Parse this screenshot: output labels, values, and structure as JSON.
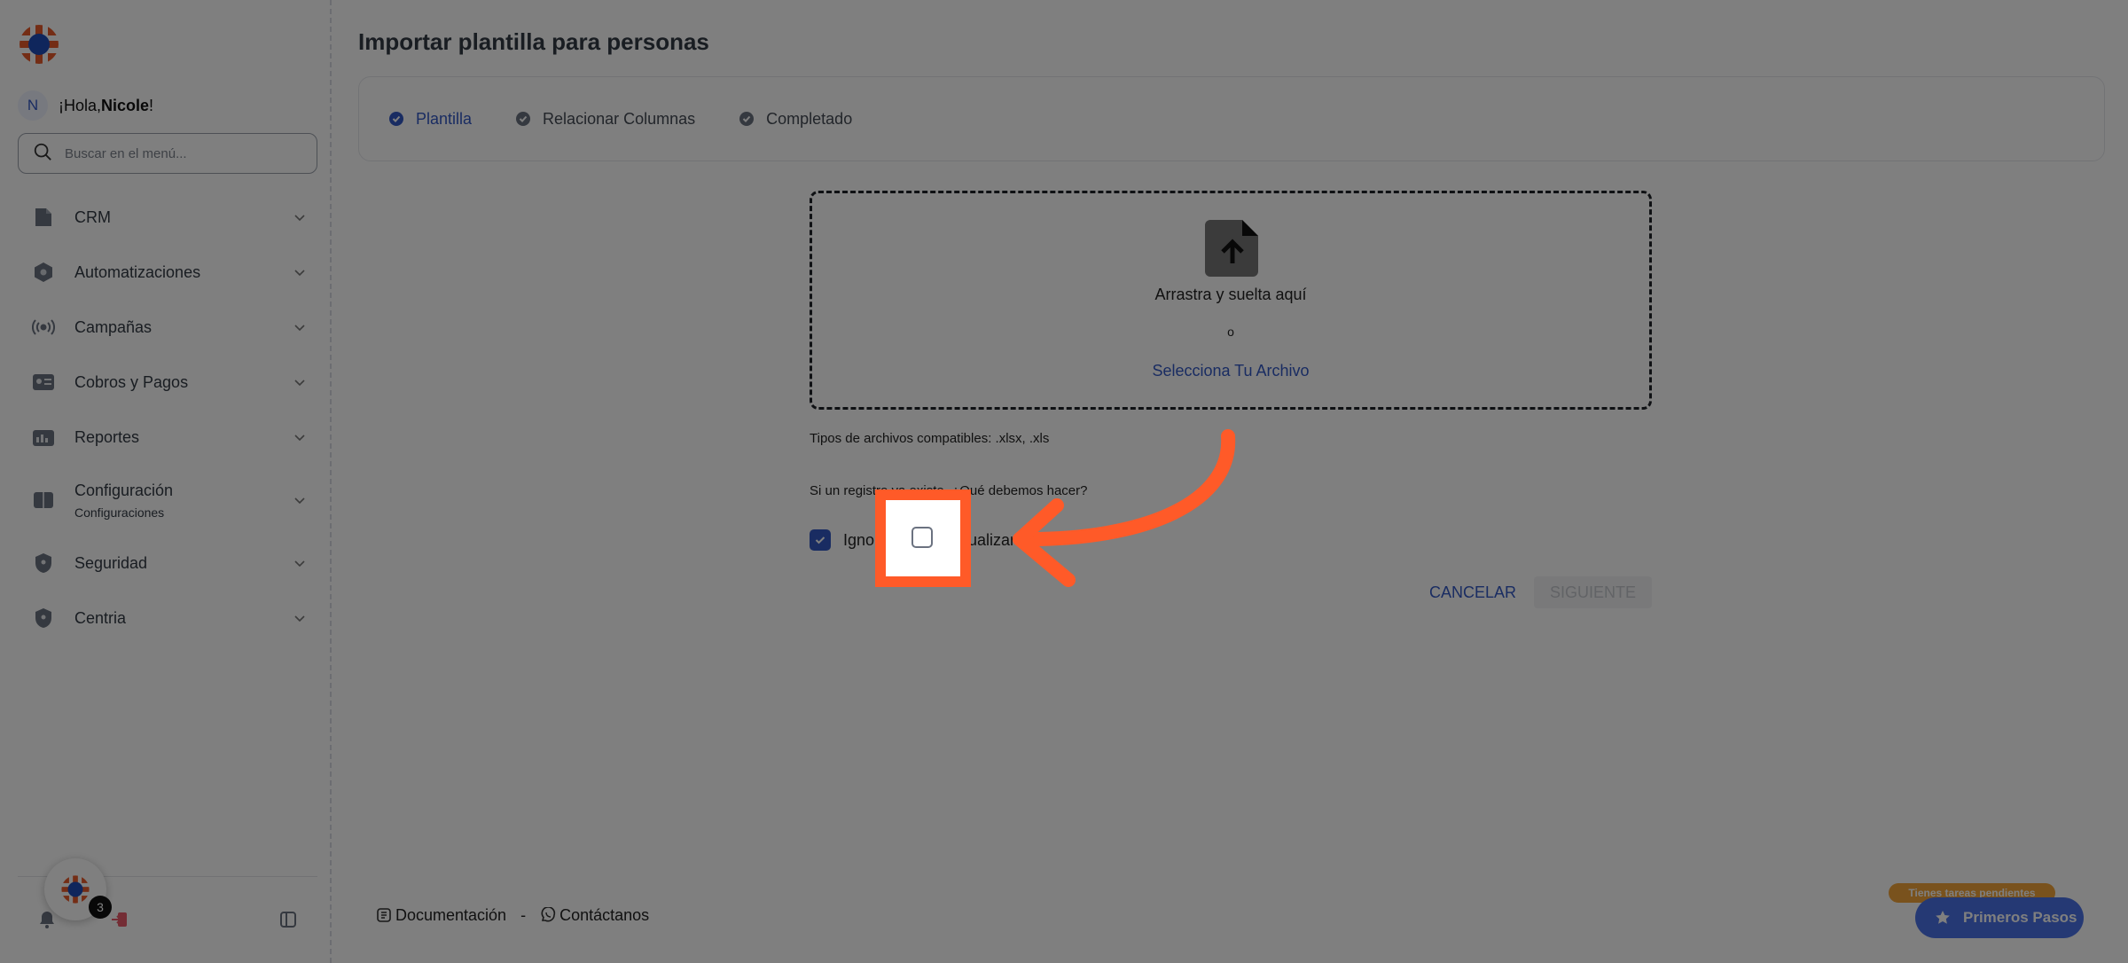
{
  "sidebar": {
    "avatar_initial": "N",
    "greeting_prefix": "¡Hola, ",
    "user_name": "Nicole",
    "greeting_suffix": "!",
    "search_placeholder": "Buscar en el menú...",
    "items": [
      {
        "label": "CRM",
        "icon": "file-icon"
      },
      {
        "label": "Automatizaciones",
        "icon": "hexagon-icon"
      },
      {
        "label": "Campañas",
        "icon": "broadcast-icon"
      },
      {
        "label": "Cobros y Pagos",
        "icon": "id-card-icon"
      },
      {
        "label": "Reportes",
        "icon": "chart-card-icon"
      },
      {
        "label": "Configuración",
        "sublabel": "Configuraciones",
        "icon": "book-icon"
      },
      {
        "label": "Seguridad",
        "icon": "shield-icon"
      },
      {
        "label": "Centria",
        "icon": "shield-icon"
      }
    ],
    "notification_count": "3"
  },
  "page": {
    "title": "Importar plantilla para personas"
  },
  "stepper": {
    "steps": [
      {
        "label": "Plantilla",
        "state": "active"
      },
      {
        "label": "Relacionar Columnas",
        "state": "pending"
      },
      {
        "label": "Completado",
        "state": "pending"
      }
    ]
  },
  "upload": {
    "drag_text": "Arrastra y suelta aquí",
    "or_text": "o",
    "select_link": "Selecciona Tu Archivo",
    "file_types": "Tipos de archivos compatibles: .xlsx, .xls"
  },
  "duplicate": {
    "question": "Si un registro ya existe, ¿Qué debemos hacer?",
    "ignore_label": "Ignorar",
    "ignore_checked": true,
    "update_label": "Actualizar",
    "update_checked": false
  },
  "actions": {
    "cancel": "CANCELAR",
    "next": "SIGUIENTE"
  },
  "footer": {
    "docs": "Documentación",
    "separator": "-",
    "contact": "Contáctanos"
  },
  "widget": {
    "pending_tag": "Tienes tareas pendientes",
    "button": "Primeros Pasos"
  },
  "colors": {
    "accent": "#3358c4",
    "highlight": "#ff5a28",
    "pending": "#f2a53a"
  }
}
